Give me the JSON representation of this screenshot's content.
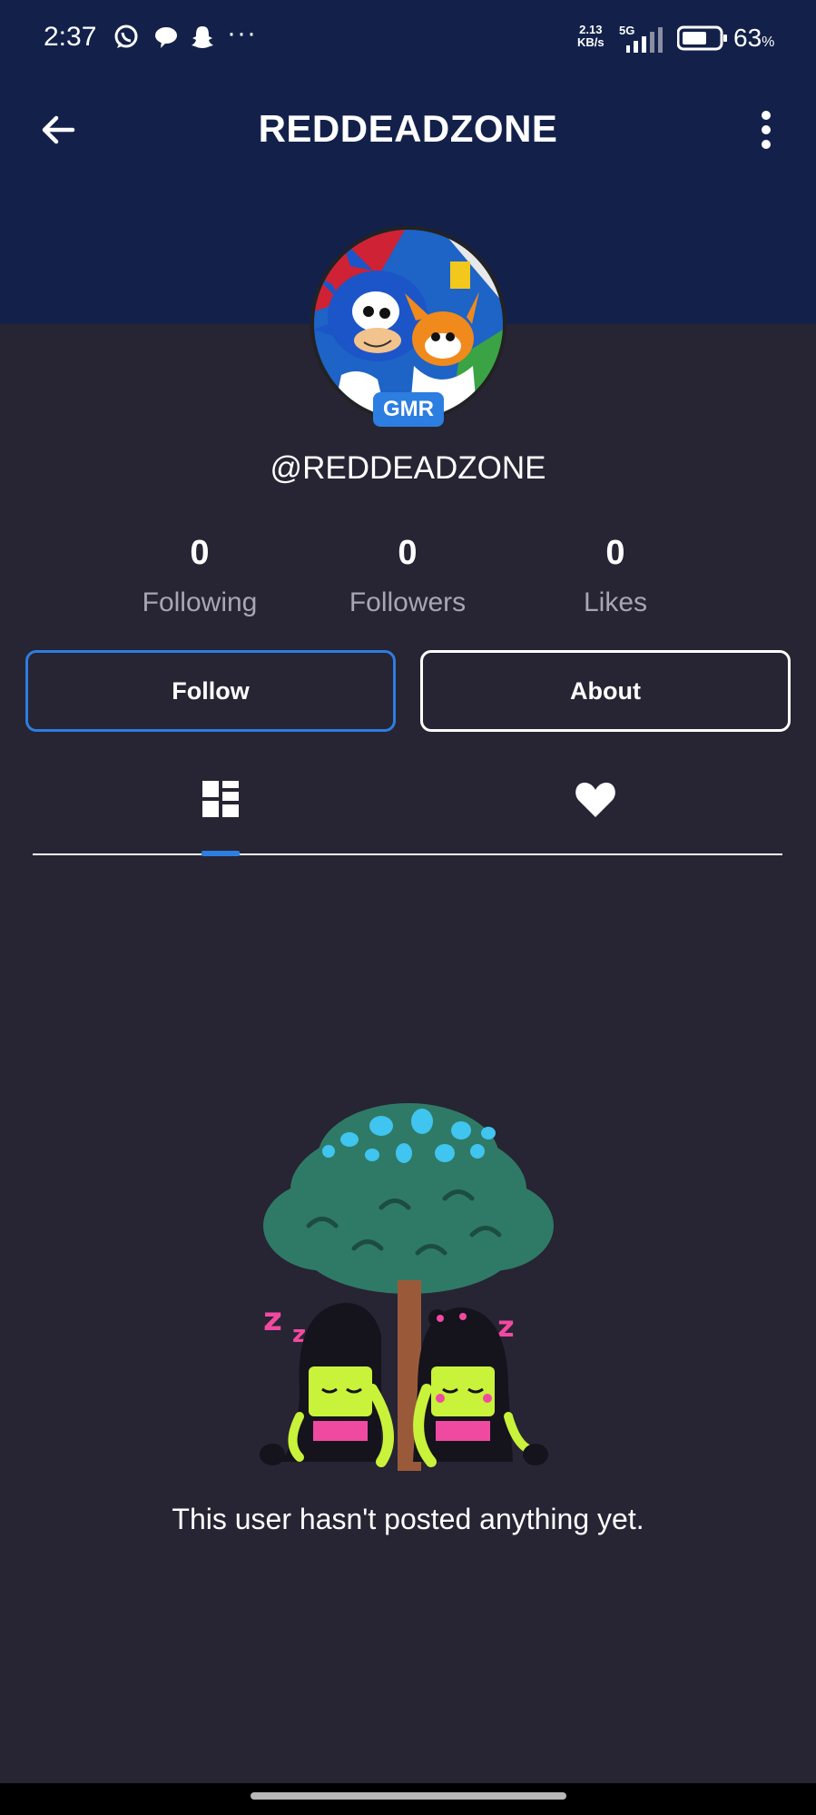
{
  "status_bar": {
    "time": "2:37",
    "notification_icons": [
      "whatsapp-icon",
      "chat-bubble-icon",
      "snapchat-icon"
    ],
    "more_notifications": "···",
    "net_speed_value": "2.13",
    "net_speed_unit": "KB/s",
    "network_type": "5G",
    "battery_percent": "63",
    "battery_unit": "%"
  },
  "top_bar": {
    "title": "REDDEADZONE"
  },
  "profile": {
    "avatar_badge": "GMR",
    "username": "@REDDEADZONE"
  },
  "stats": [
    {
      "value": "0",
      "label": "Following"
    },
    {
      "value": "0",
      "label": "Followers"
    },
    {
      "value": "0",
      "label": "Likes"
    }
  ],
  "actions": {
    "follow_label": "Follow",
    "about_label": "About"
  },
  "tabs": [
    {
      "icon": "dashboard-grid-icon",
      "active": true
    },
    {
      "icon": "heart-icon",
      "active": false
    }
  ],
  "empty_state": {
    "message": "This user hasn't posted anything yet."
  },
  "colors": {
    "header_bg": "#13214a",
    "page_bg": "#272434",
    "accent": "#2c7ee0",
    "muted_text": "#a9a6b4"
  }
}
